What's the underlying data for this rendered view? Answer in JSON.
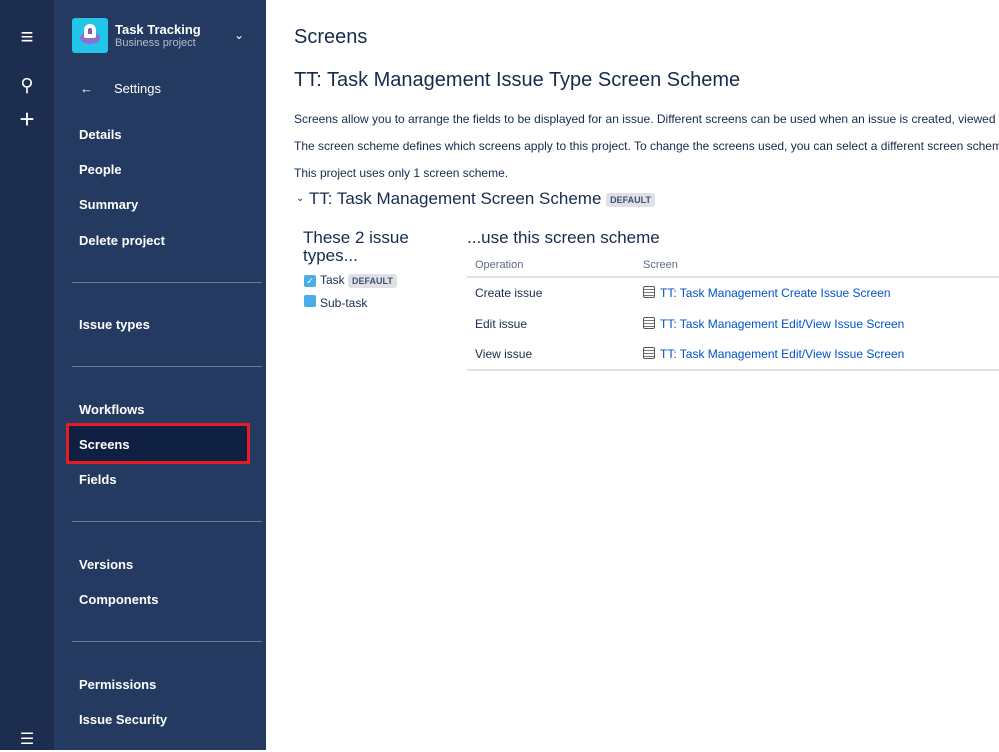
{
  "project": {
    "name": "Task Tracking",
    "type": "Business project"
  },
  "sidebar": {
    "back_label": "Settings",
    "items": [
      "Details",
      "People",
      "Summary",
      "Delete project",
      "Issue types",
      "Workflows",
      "Screens",
      "Fields",
      "Versions",
      "Components",
      "Permissions",
      "Issue Security"
    ],
    "selected": "Screens"
  },
  "main": {
    "title": "Screens",
    "subtitle": "TT: Task Management Issue Type Screen Scheme",
    "para1": "Screens allow you to arrange the fields to be displayed for an issue. Different screens can be used when an issue is created, viewed",
    "para2": "The screen scheme defines which screens apply to this project. To change the screens used, you can select a different screen schem",
    "para3": "This project uses only 1 screen scheme.",
    "scheme_name": "TT: Task Management Screen Scheme",
    "default_badge": "DEFAULT",
    "issue_types_heading": "These 2 issue types...",
    "issue_types": [
      {
        "name": "Task",
        "badge": "DEFAULT"
      },
      {
        "name": "Sub-task"
      }
    ],
    "use_heading": "...use this screen scheme",
    "columns": [
      "Operation",
      "Screen"
    ],
    "rows": [
      {
        "op": "Create issue",
        "screen": "TT: Task Management Create Issue Screen"
      },
      {
        "op": "Edit issue",
        "screen": "TT: Task Management Edit/View Issue Screen"
      },
      {
        "op": "View issue",
        "screen": "TT: Task Management Edit/View Issue Screen"
      }
    ]
  }
}
